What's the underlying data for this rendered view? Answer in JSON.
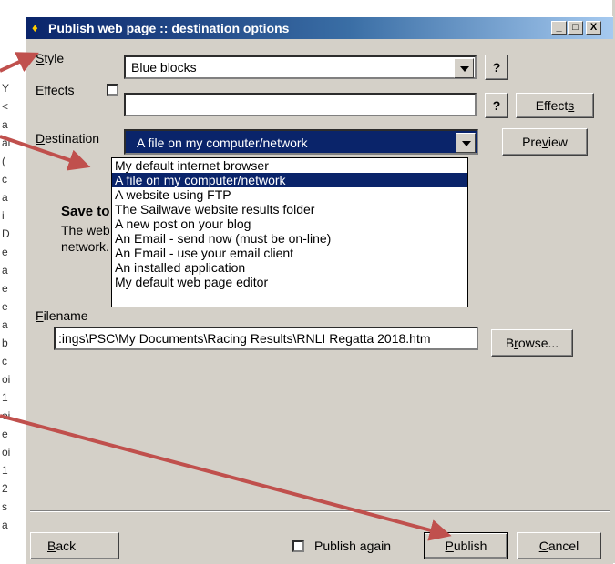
{
  "window": {
    "title": "Publish web page :: destination options"
  },
  "titlebar_buttons": {
    "minimize": "_",
    "maximize": "□",
    "close": "X"
  },
  "style": {
    "label_pre": "",
    "label_ul": "S",
    "label_post": "tyle",
    "value": "Blue blocks",
    "help": "?"
  },
  "effects": {
    "label_pre": "",
    "label_ul": "E",
    "label_post": "ffects",
    "value": "",
    "help": "?",
    "button_pre": "Effect",
    "button_ul": "s",
    "button_post": ""
  },
  "destination": {
    "label_pre": "",
    "label_ul": "D",
    "label_post": "estination",
    "value": "A file on my computer/network",
    "preview_pre": "Pre",
    "preview_ul": "v",
    "preview_post": "iew"
  },
  "destination_options": [
    "My default internet browser",
    "A file on my computer/network",
    "A website using FTP",
    "The Sailwave website results folder",
    "A new post on your blog",
    "An Email - send now (must be on-line)",
    "An Email - use your email client",
    "An installed application",
    "My default web page editor"
  ],
  "info": {
    "heading": "Save to",
    "line1": "The web p",
    "line2": "network."
  },
  "filename": {
    "label_pre": "",
    "label_ul": "F",
    "label_post": "ilename",
    "value": ":ings\\PSC\\My Documents\\Racing Results\\RNLI Regatta 2018.htm",
    "browse_pre": "B",
    "browse_ul": "r",
    "browse_post": "owse..."
  },
  "footer": {
    "back_pre": "",
    "back_ul": "B",
    "back_post": "ack",
    "publish_again": "Publish again",
    "publish_pre": "",
    "publish_ul": "P",
    "publish_post": "ublish",
    "cancel_pre": "",
    "cancel_ul": "C",
    "cancel_post": "ancel"
  },
  "background_glyphs": [
    "Y",
    "<",
    "a",
    "al",
    "(",
    "c",
    "a",
    "i",
    "D",
    "e",
    "a",
    "e",
    "e",
    "a",
    "b",
    "c",
    "oi",
    "1",
    "oi",
    "e",
    "oi",
    "1",
    "2",
    "s",
    "a"
  ],
  "colors": {
    "titlebar": "#0a246a",
    "selection": "#0a246a",
    "annotation_arrow": "#c0504d",
    "dialog": "#d4d0c8"
  }
}
